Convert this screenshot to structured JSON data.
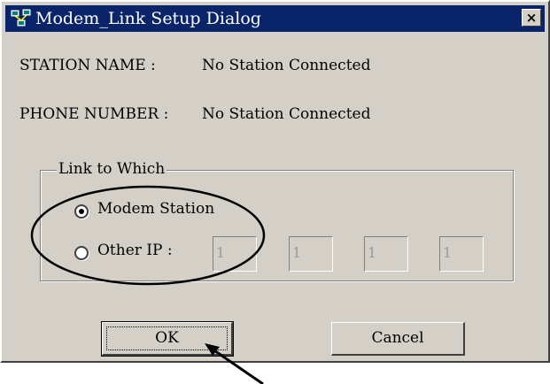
{
  "window": {
    "title": "Modem_Link Setup Dialog",
    "close_glyph": "×",
    "icon": "network-stations-icon"
  },
  "info": {
    "station_label": "STATION NAME :",
    "station_value": "No Station Connected",
    "phone_label": "PHONE NUMBER :",
    "phone_value": "No Station Connected"
  },
  "link_group": {
    "legend": "Link to Which",
    "options": [
      {
        "label": "Modem Station",
        "selected": true
      },
      {
        "label": "Other IP :",
        "selected": false
      }
    ],
    "ip_octets": [
      "1",
      "1",
      "1",
      "1"
    ]
  },
  "buttons": {
    "ok": "OK",
    "cancel": "Cancel"
  },
  "annotations": {
    "ellipse_color": "#000000",
    "arrow_color": "#000000"
  },
  "colors": {
    "titlebar": "#0a246a",
    "dialog_face": "#d4d0c8"
  }
}
